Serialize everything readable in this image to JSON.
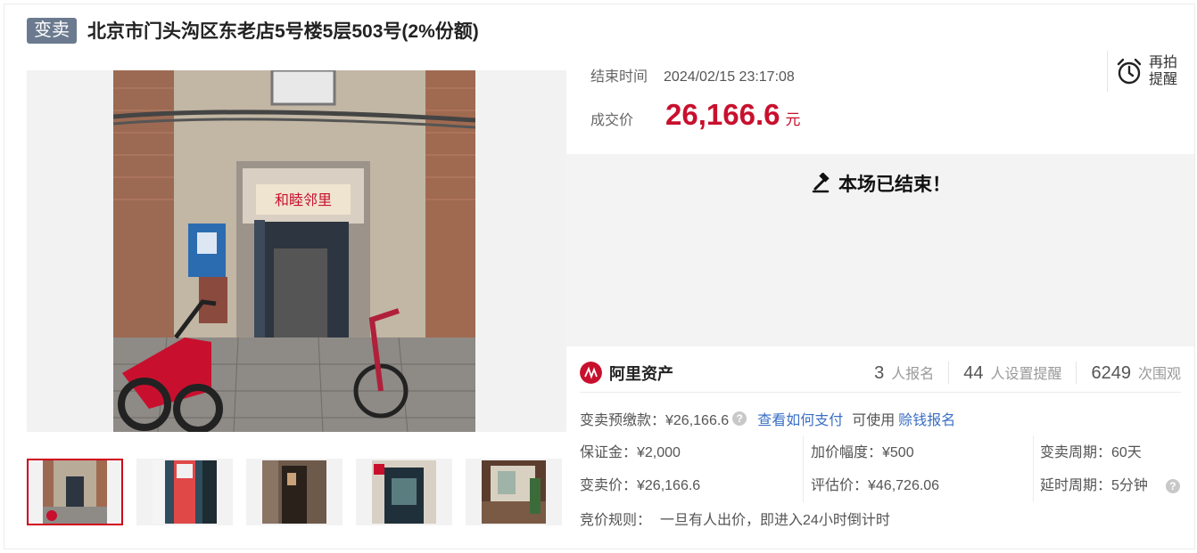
{
  "header": {
    "tag": "变卖",
    "title": "北京市门头沟区东老店5号楼5层503号(2%份额)"
  },
  "gallery": {
    "main_image": "building-entrance-photo",
    "thumbnails": [
      "entrance-photo",
      "floor-5-sign-photo",
      "stairwell-door-photo",
      "apartment-door-photo",
      "interior-room-photo"
    ],
    "sign_text": "和睦邻里"
  },
  "auction": {
    "end_label": "结束时间",
    "end_value": "2024/02/15 23:17:08",
    "price_label": "成交价",
    "price_value": "26,166.6",
    "price_unit": "元",
    "remind_label": "再拍提醒",
    "ended_text": "本场已结束！",
    "accent_color": "#c8102e"
  },
  "platform": {
    "name": "阿里资产",
    "stats": [
      {
        "number": "3",
        "unit": "人报名"
      },
      {
        "number": "44",
        "unit": "人设置提醒"
      },
      {
        "number": "6249",
        "unit": "次围观"
      }
    ]
  },
  "details": {
    "deposit_label": "变卖预缴款：¥26,166.6",
    "how_to_pay": "查看如何支付",
    "can_use": "可使用",
    "loan_signup": "赊钱报名",
    "col1": [
      "保证金：¥2,000",
      "变卖价：¥26,166.6"
    ],
    "col2": [
      "加价幅度：¥500",
      "评估价：¥46,726.06"
    ],
    "col3": [
      "变卖周期：60天",
      "延时周期：5分钟"
    ],
    "rule_label": "竞价规则：",
    "rule_value": "一旦有人出价，即进入24小时倒计时"
  }
}
